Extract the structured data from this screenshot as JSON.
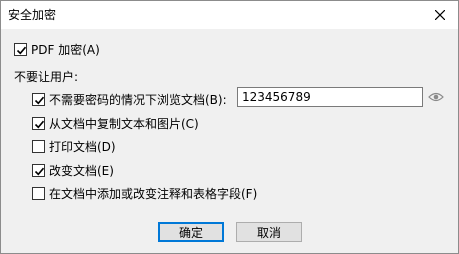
{
  "window": {
    "title": "安全加密"
  },
  "encrypt": {
    "label": "PDF 加密(A)",
    "checked": true
  },
  "restrictions": {
    "heading": "不要让用户:",
    "items": [
      {
        "label": "不需要密码的情况下浏览文档(B):",
        "checked": true
      },
      {
        "label": "从文档中复制文本和图片(C)",
        "checked": true
      },
      {
        "label": "打印文档(D)",
        "checked": false
      },
      {
        "label": "改变文档(E)",
        "checked": true
      },
      {
        "label": "在文档中添加或改变注释和表格字段(F)",
        "checked": false
      }
    ]
  },
  "password": {
    "value": "123456789"
  },
  "buttons": {
    "ok": "确定",
    "cancel": "取消"
  },
  "icons": {
    "close": "close-icon",
    "show_password": "eye-icon"
  },
  "colors": {
    "focus_border": "#0078d7",
    "check": "#000000"
  }
}
